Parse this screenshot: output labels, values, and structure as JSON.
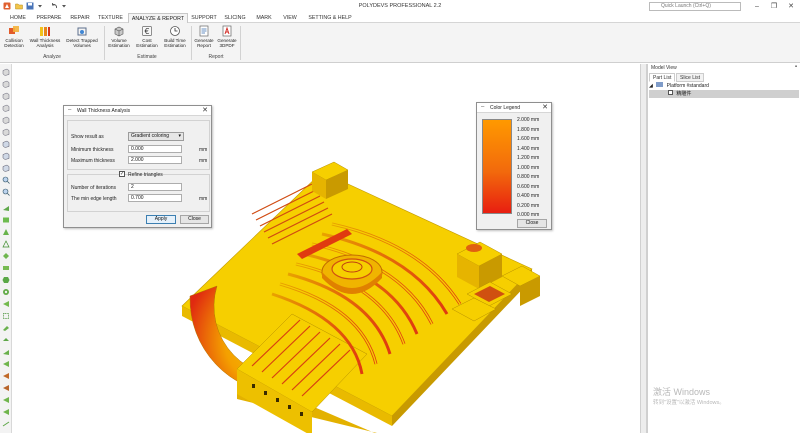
{
  "app": {
    "title": "POLYDEVS PROFESSIONAL 2.2",
    "quick_launch_placeholder": "Quick Launch (Ctrl+Q)"
  },
  "menu": {
    "tabs": [
      "HOME",
      "PREPARE",
      "REPAIR",
      "TEXTURE",
      "ANALYZE & REPORT",
      "SUPPORT",
      "SLICING",
      "MARK",
      "VIEW",
      "SETTING & HELP"
    ],
    "active": "ANALYZE & REPORT"
  },
  "ribbon": {
    "analyze_group": "Analyze",
    "estimate_group": "Estimate",
    "report_group": "Report",
    "collision": [
      "Collision",
      "Detection"
    ],
    "wall_thickness": [
      "Wall Thickness",
      "Analysis"
    ],
    "trapped": [
      "Detect Trapped",
      "Volumes"
    ],
    "volume": [
      "Volume",
      "Estimation"
    ],
    "cost": [
      "Cost",
      "Estimation"
    ],
    "build_time": [
      "Build Time",
      "Estimation"
    ],
    "gen_report": [
      "Generate",
      "Report"
    ],
    "gen_3dpdf": [
      "Generate",
      "3DPDF"
    ]
  },
  "wall_dialog": {
    "title": "Wall Thickness Analysis",
    "show_result_label": "Show result as",
    "show_result_value": "Gradient coloring",
    "min_label": "Minimum thickness",
    "min_value": "0.000",
    "max_label": "Maximum thickness",
    "max_value": "2.000",
    "unit": "mm",
    "refine_label": "Refine triangles",
    "refine_checked": true,
    "iterations_label": "Number of iterations",
    "iterations_value": "2",
    "edge_label": "The min edge length",
    "edge_value": "0.700",
    "apply": "Apply",
    "close": "Close"
  },
  "legend_dialog": {
    "title": "Color Legend",
    "ticks": [
      "2.000 mm",
      "1.800 mm",
      "1.600 mm",
      "1.400 mm",
      "1.200 mm",
      "1.000 mm",
      "0.800 mm",
      "0.600 mm",
      "0.400 mm",
      "0.200 mm",
      "0.000 mm"
    ],
    "close": "Close",
    "gradient_top": "#ff9900",
    "gradient_bottom": "#e81e10"
  },
  "model_view": {
    "title": "Model View",
    "tabs": [
      "Part List",
      "Slice List"
    ],
    "platform": "Platform #standard",
    "part": "精雕件"
  },
  "watermark": {
    "line1": "激活 Windows",
    "line2": "转到\"设置\"以激活 Windows。"
  },
  "colors": {
    "model_yellow": "#f6cf00",
    "model_red": "#e02010",
    "accent": "#d0d0d0"
  }
}
